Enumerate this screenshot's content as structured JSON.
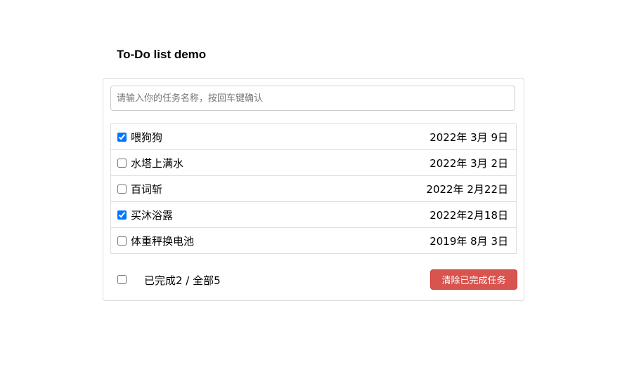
{
  "header": {
    "title": "To-Do list demo"
  },
  "input": {
    "placeholder": "请输入你的任务名称，按回车键确认",
    "value": ""
  },
  "todos": [
    {
      "name": "喂狗狗",
      "date": "2022年 3月 9日",
      "done": true
    },
    {
      "name": "水塔上满水",
      "date": "2022年 3月 2日",
      "done": false
    },
    {
      "name": "百词斩",
      "date": "2022年 2月22日",
      "done": false
    },
    {
      "name": "买沐浴露",
      "date": "2022年2月18日",
      "done": true
    },
    {
      "name": "体重秤换电池",
      "date": "2019年 8月 3日",
      "done": false
    }
  ],
  "footer": {
    "select_all": false,
    "count_text": "已完成2 / 全部5",
    "clear_label": "清除已完成任务"
  },
  "colors": {
    "danger": "#d9534f",
    "checkbox_accent": "#0075ff"
  }
}
